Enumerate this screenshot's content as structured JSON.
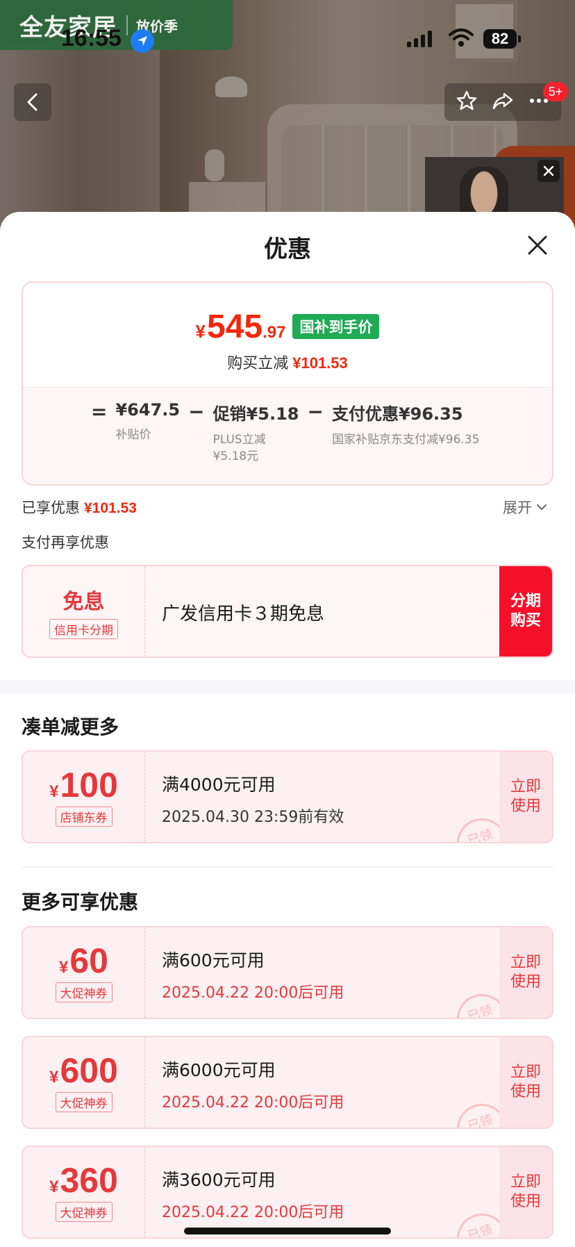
{
  "status_bar": {
    "time": "16:55",
    "battery": "82"
  },
  "brand": {
    "name": "全友家居",
    "sub": "放价季"
  },
  "top_badge": "5+",
  "sheet": {
    "title": "优惠",
    "price": {
      "currency": "¥",
      "integer": "545",
      "decimal": ".97",
      "tag": "国补到手价"
    },
    "reduce": {
      "label": "购买立减",
      "value": "¥101.53"
    },
    "formula": {
      "eq": "=",
      "base_value": "¥647.5",
      "base_label": "补贴价",
      "minus1": "−",
      "promo_value": "促销¥5.18",
      "promo_label1": "PLUS立减",
      "promo_label2": "¥5.18元",
      "minus2": "−",
      "pay_value": "支付优惠¥96.35",
      "pay_label": "国家补贴京东支付减¥96.35"
    },
    "enjoyed": {
      "label": "已享优惠",
      "value": "¥101.53",
      "expand": "展开"
    },
    "pay_more": "支付再享优惠",
    "installment": {
      "title": "免息",
      "tag": "信用卡分期",
      "text": "广发信用卡３期免息",
      "button": "分期购买"
    },
    "section1": "凑单减更多",
    "store_coupon": {
      "currency": "¥",
      "amount": "100",
      "tag": "店铺东券",
      "condition": "满4000元可用",
      "date": "2025.04.30 23:59前有效",
      "use": "立即使用",
      "stamp": "已领"
    },
    "section2": "更多可享优惠",
    "more_coupons": [
      {
        "currency": "¥",
        "amount": "60",
        "tag": "大促神券",
        "condition": "满600元可用",
        "date": "2025.04.22 20:00后可用",
        "use": "立即使用",
        "stamp": "已领"
      },
      {
        "currency": "¥",
        "amount": "600",
        "tag": "大促神券",
        "condition": "满6000元可用",
        "date": "2025.04.22 20:00后可用",
        "use": "立即使用",
        "stamp": "已领"
      },
      {
        "currency": "¥",
        "amount": "360",
        "tag": "大促神券",
        "condition": "满3600元可用",
        "date": "2025.04.22 20:00后可用",
        "use": "立即使用",
        "stamp": "已领"
      }
    ]
  },
  "icons": [
    "location-arrow-icon",
    "cellular-signal-icon",
    "wifi-icon",
    "battery-icon",
    "back-arrow-icon",
    "star-icon",
    "share-icon",
    "more-icon",
    "close-icon",
    "chevron-down-icon"
  ],
  "colors": {
    "accent_red": "#f2270c",
    "green_tag": "#1faa55",
    "brand_green": "#2b6a3b"
  }
}
